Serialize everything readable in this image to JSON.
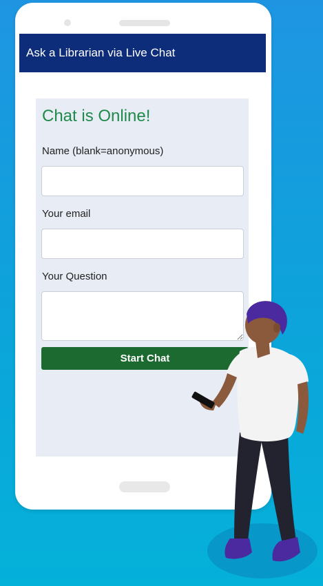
{
  "header": {
    "title": "Ask a Librarian via Live Chat"
  },
  "chat": {
    "status": "Chat is Online!",
    "name_label": "Name (blank=anonymous)",
    "name_value": "",
    "email_label": "Your email",
    "email_value": "",
    "question_label": "Your Question",
    "question_value": "",
    "start_label": "Start Chat"
  },
  "colors": {
    "header_bg": "#0d2d7a",
    "status_green": "#1f8a4b",
    "button_green": "#1d6a30",
    "panel_bg": "#e7ecf5",
    "background_blue": "#1f95e2"
  },
  "illustration": {
    "icon": "person-with-phone-icon"
  }
}
